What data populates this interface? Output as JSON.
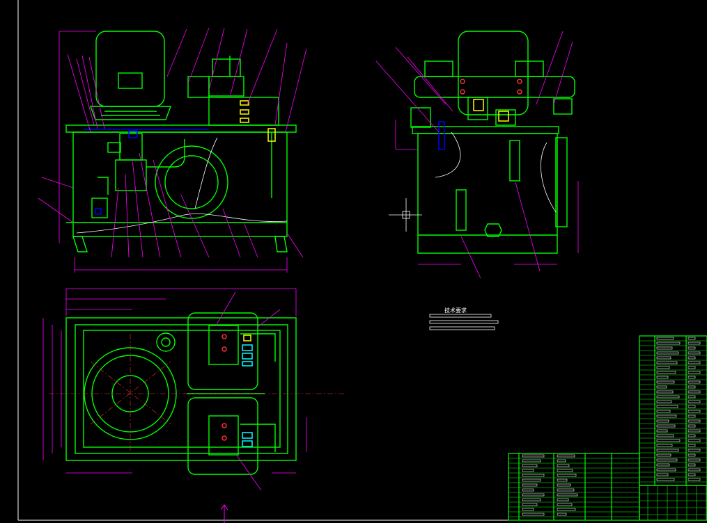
{
  "drawing": {
    "tech_req_title": "技术要求",
    "tech_req_lines": 3,
    "colors": {
      "background": "#000000",
      "outline": "#00ff00",
      "leader": "#ff00ff",
      "frame": "#ffffff",
      "text": "#ffffff",
      "fitting_yellow": "#ffff00",
      "fitting_blue": "#0000ff",
      "fitting_cyan": "#00ffff",
      "hatch_red": "#ff3030"
    },
    "views": {
      "front": "front-view",
      "side": "side-view",
      "top": "top-view"
    },
    "icons": {
      "crosshair": "crosshair-icon",
      "north_arrow": "arrow-up-icon"
    }
  }
}
